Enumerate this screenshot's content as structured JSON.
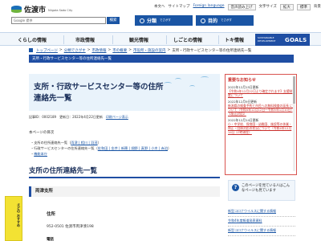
{
  "site": {
    "logo_text": "佐渡市",
    "logo_sub": "Niigata Sado City"
  },
  "util_links": {
    "sitemap": "本文へ",
    "site_map": "サイトマップ",
    "foreign": "Foreign language",
    "voice": "音声読み上げ",
    "text_size_label": "文字サイズ",
    "zoom": "拡大",
    "standard": "標準",
    "bg_color_label": "背景色の変更"
  },
  "search": {
    "placeholder": "Google 提供",
    "button_label": "検索"
  },
  "quick_buttons": [
    {
      "label": "分類",
      "sub": "でさがす"
    },
    {
      "label": "目的",
      "sub": "でさがす"
    }
  ],
  "nav": {
    "items": [
      "くらしの情報",
      "市政情報",
      "観光情報",
      "しごとの情報",
      "トキ情報"
    ],
    "sdg_small": "SUSTAINABLE DEVELOPMENT",
    "sdg_goals": "GOALS"
  },
  "breadcrumb": {
    "items": [
      "トップページ",
      "分類でさがす",
      "市政情報",
      "市の概要",
      "市役所・施設の案内"
    ],
    "current": "支所・行政サービスセンター等の住所連絡先一覧"
  },
  "title_strip": "支所・行政サービスセンター等の住所連絡先一覧",
  "page": {
    "title": "支所・行政サービスセンター等の住所連絡先一覧",
    "meta_id": "記事ID：0002189",
    "meta_updated": "更新日：2022年4月22日更新",
    "meta_print": "印刷ページ表示",
    "toc_label": "本ページの目次",
    "toc_lines": [
      {
        "prefix": "支所の住所連絡先一覧（",
        "links": "両津 | 相川 | 羽茂",
        "suffix": "）"
      },
      {
        "prefix": "行政サービスセンターの住所連絡先一覧（",
        "links": "佐和田 | 金井 | 新穂 | 畑野 | 真野 | 小木 | 赤泊",
        "suffix": "）"
      },
      {
        "prefix": "",
        "links": "機能本庁",
        "suffix": ""
      }
    ],
    "section_heading": "支所の住所連絡先一覧",
    "sub_heading": "両津支所",
    "address_label": "住所",
    "address_value": "952-0501 佐渡市両津湊198",
    "next_label": "電話"
  },
  "side_banner": {
    "text": "さどの おすすめ"
  },
  "notices": {
    "title": "重要なお知らせ",
    "entries": [
      {
        "date": "2022年12月15日更新",
        "text": "【令和4年12月22日より確定されます】支援制度について"
      },
      {
        "date": "2022年12月9日更新",
        "text": "新潟県の検査予約と市民への無料検査の延長 について（令和4年12月12日～令和5年1月10日）【振込対応】"
      },
      {
        "date": "2022年12月14日更新",
        "text": "小・中学校、保育園・幼稚園、施設等の休業・休止・団体対応の状況について（令和4年12月14日 17時現在）"
      }
    ],
    "more": "一覧を見る"
  },
  "help": {
    "icon": "?",
    "text": "このページを見ている人はこんなページも見ています"
  },
  "related": [
    "新型コロナウイルスに関する情報",
    "令和4年度報道発表資料",
    "新型コロナウイルスに関する情報"
  ]
}
